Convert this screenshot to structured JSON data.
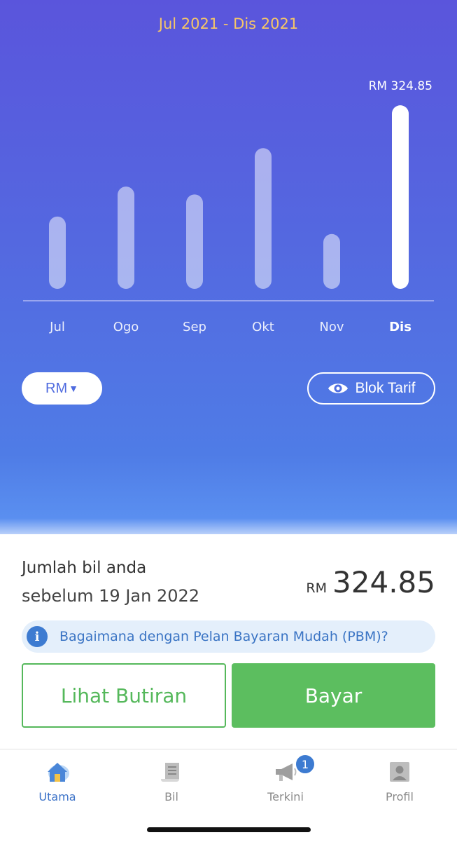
{
  "header": {
    "period": "Jul 2021 - Dis 2021"
  },
  "chart_data": {
    "type": "bar",
    "categories": [
      "Jul",
      "Ogo",
      "Sep",
      "Okt",
      "Nov",
      "Dis"
    ],
    "values": [
      128,
      181,
      167,
      249,
      97,
      324.85
    ],
    "highlight_index": 5,
    "highlight_label": "RM 324.85",
    "ylim": [
      0,
      330
    ],
    "grid": false
  },
  "controls": {
    "unit_label": "RM",
    "tarif_label": "Blok Tarif"
  },
  "summary": {
    "title": "Jumlah bil anda",
    "due": "sebelum 19 Jan 2022",
    "currency": "RM",
    "amount": "324.85"
  },
  "info": {
    "text": "Bagaimana dengan Pelan Bayaran Mudah (PBM)?",
    "icon": "info-icon"
  },
  "actions": {
    "details_label": "Lihat Butiran",
    "pay_label": "Bayar"
  },
  "tabs": [
    {
      "label": "Utama",
      "icon": "home-icon",
      "active": true
    },
    {
      "label": "Bil",
      "icon": "bill-icon",
      "active": false
    },
    {
      "label": "Terkini",
      "icon": "megaphone-icon",
      "active": false,
      "badge": "1"
    },
    {
      "label": "Profil",
      "icon": "profile-icon",
      "active": false
    }
  ],
  "colors": {
    "accent": "#3d73c8",
    "pay": "#5cbe5f",
    "period": "#f6c667"
  }
}
